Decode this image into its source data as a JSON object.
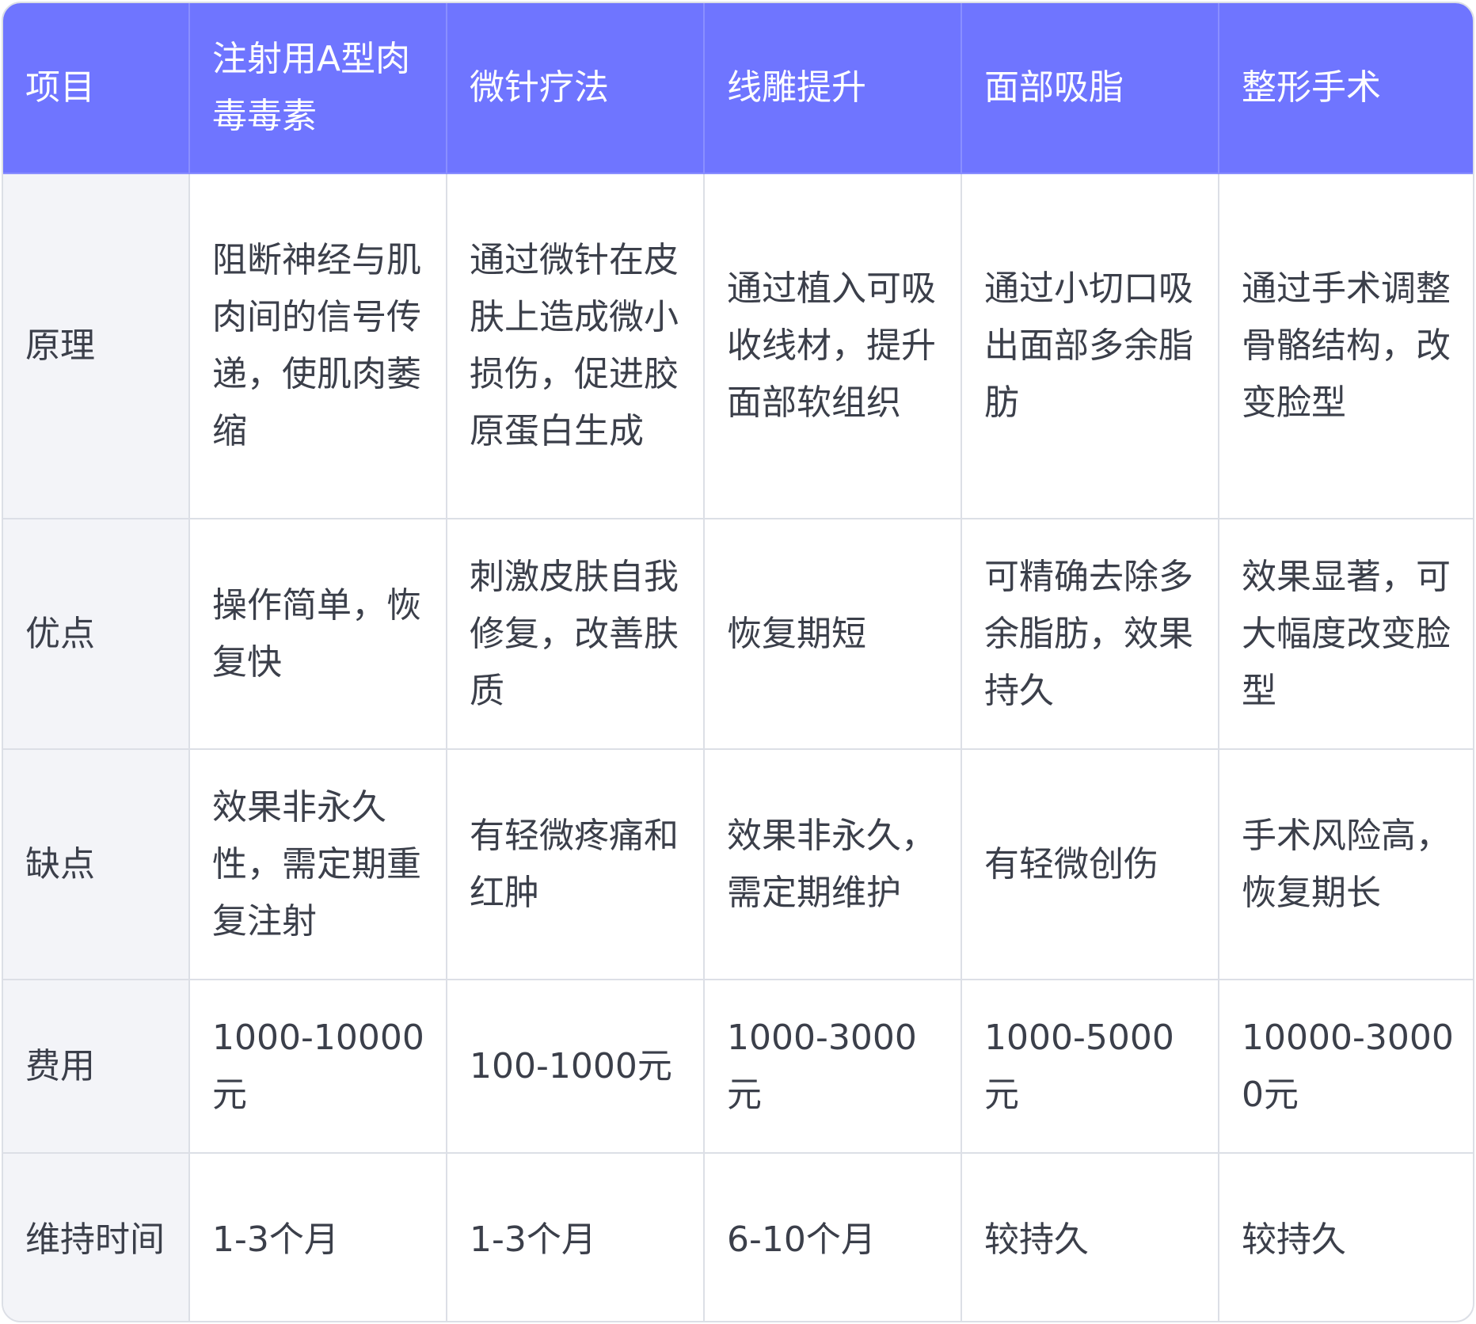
{
  "colors": {
    "header_background": "#6f75ff",
    "header_text": "#ffffff",
    "first_column_background": "#f3f4f8",
    "body_text": "#3b3f4a",
    "border": "#dcdfe6"
  },
  "table": {
    "headers": [
      "项目",
      "注射用A型肉毒毒素",
      "微针疗法",
      "线雕提升",
      "面部吸脂",
      "整形手术"
    ],
    "rows": [
      {
        "label": "原理",
        "cells": [
          "阻断神经与肌肉间的信号传递，使肌肉萎缩",
          "通过微针在皮肤上造成微小损伤，促进胶原蛋白生成",
          "通过植入可吸收线材，提升面部软组织",
          "通过小切口吸出面部多余脂肪",
          "通过手术调整骨骼结构，改变脸型"
        ]
      },
      {
        "label": "优点",
        "cells": [
          "操作简单，恢复快",
          "刺激皮肤自我修复，改善肤质",
          "恢复期短",
          "可精确去除多余脂肪，效果持久",
          "效果显著，可大幅度改变脸型"
        ]
      },
      {
        "label": "缺点",
        "cells": [
          "效果非永久性，需定期重复注射",
          "有轻微疼痛和红肿",
          "效果非永久，需定期维护",
          "有轻微创伤",
          "手术风险高，恢复期长"
        ]
      },
      {
        "label": "费用",
        "cells": [
          "1000-10000元",
          "100-1000元",
          "1000-3000元",
          "1000-5000元",
          "10000-30000元"
        ]
      },
      {
        "label": "维持时间",
        "cells": [
          "1-3个月",
          "1-3个月",
          "6-10个月",
          "较持久",
          "较持久"
        ]
      }
    ]
  }
}
